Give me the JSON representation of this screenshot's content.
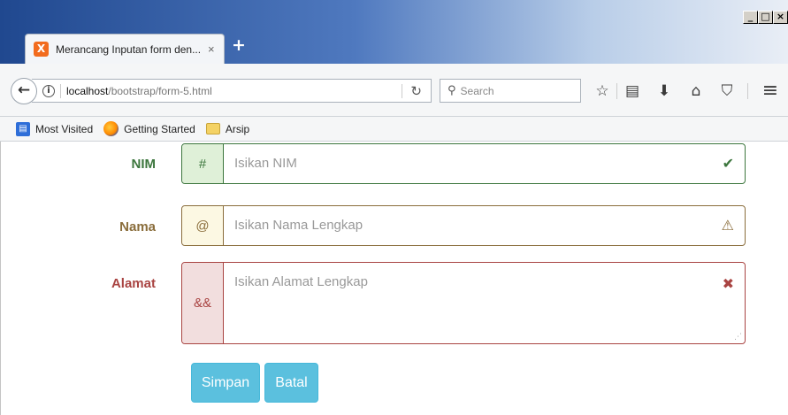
{
  "window": {
    "controls": [
      "_",
      "□",
      "×"
    ]
  },
  "tab": {
    "favicon": "X",
    "title": "Merancang Inputan form den...",
    "close_glyph": "×",
    "new_tab_glyph": "+"
  },
  "navbar": {
    "back_glyph": "←",
    "info_glyph": "i",
    "url_host": "localhost",
    "url_path": "/bootstrap/form-5.html",
    "reload_glyph": "↻",
    "search_glyph": "⚲",
    "search_placeholder": "Search",
    "toolbar_icons": [
      {
        "name": "bookmark-star-icon",
        "glyph": "☆"
      },
      {
        "name": "bookmarks-library-icon",
        "glyph": "▤"
      },
      {
        "name": "downloads-icon",
        "glyph": "⬇"
      },
      {
        "name": "home-icon",
        "glyph": "⌂"
      },
      {
        "name": "pocket-icon",
        "glyph": "⛉"
      },
      {
        "name": "menu-icon",
        "glyph": "≡"
      }
    ]
  },
  "bookmarks": [
    {
      "label": "Most Visited"
    },
    {
      "label": "Getting Started"
    },
    {
      "label": "Arsip"
    }
  ],
  "form": {
    "nim": {
      "label": "NIM",
      "addon": "#",
      "placeholder": "Isikan NIM",
      "status": "success",
      "status_glyph": "✔",
      "color": "#3c763d"
    },
    "nama": {
      "label": "Nama",
      "addon": "@",
      "placeholder": "Isikan Nama Lengkap",
      "status": "warning",
      "status_glyph": "⚠",
      "color": "#8a6d3b"
    },
    "alamat": {
      "label": "Alamat",
      "addon": "&&",
      "placeholder": "Isikan Alamat Lengkap",
      "status": "error",
      "status_glyph": "✖",
      "color": "#a94442"
    },
    "buttons": {
      "save_label": "Simpan",
      "cancel_label": "Batal",
      "color": "#5bc0de"
    }
  }
}
